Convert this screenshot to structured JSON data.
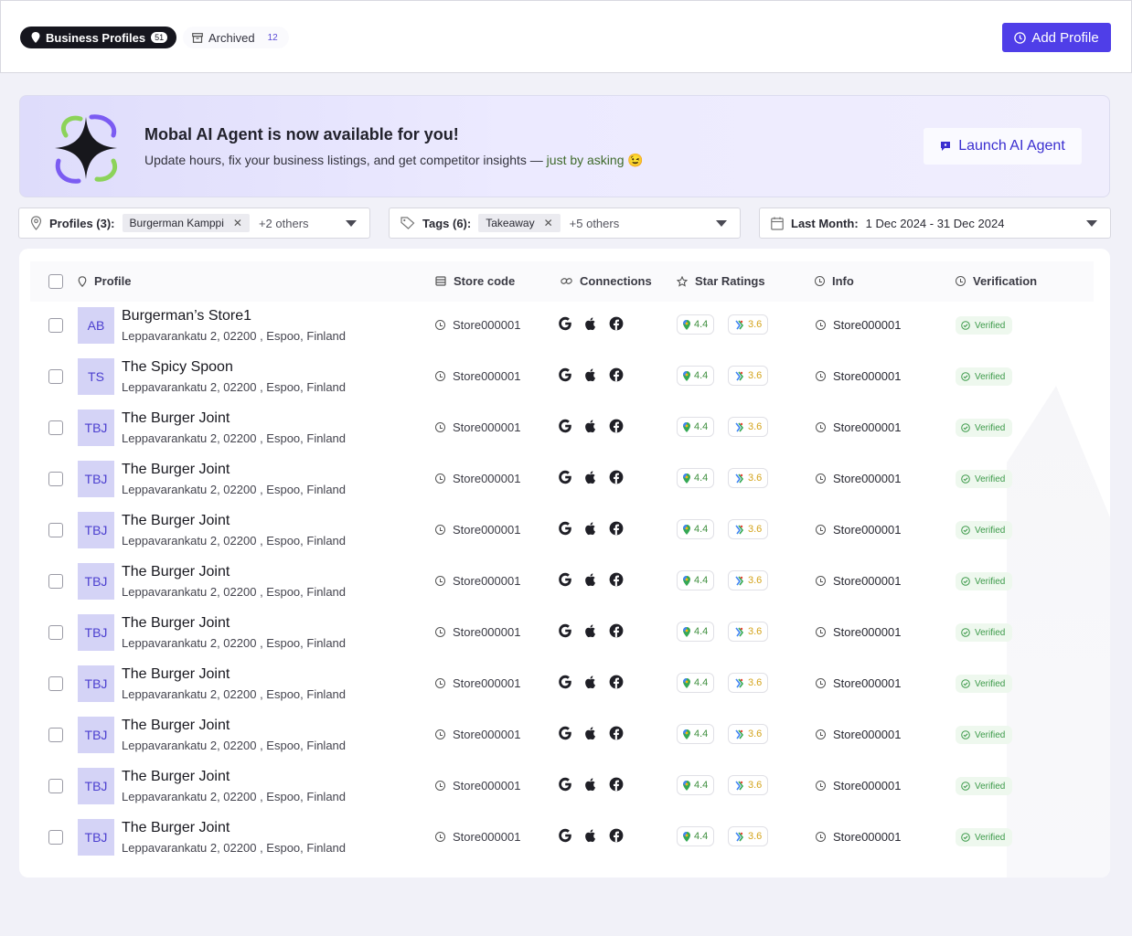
{
  "tabs": {
    "active": {
      "label": "Business Profiles",
      "count": "51"
    },
    "archived": {
      "label": "Archived",
      "count": "12"
    }
  },
  "header": {
    "add_profile_label": "Add Profile"
  },
  "banner": {
    "title": "Mobal AI Agent is now available for you!",
    "subtitle": "Update hours, fix your business listings, and get competitor insights — ",
    "subtitle_accent": "just by asking",
    "emoji": "😉",
    "launch_label": "Launch AI Agent"
  },
  "filters": {
    "profiles": {
      "label": "Profiles (3):",
      "chip": "Burgerman Kamppi",
      "others": "+2 others"
    },
    "tags": {
      "label": "Tags (6):",
      "chip": "Takeaway",
      "others": "+5 others"
    },
    "date": {
      "label": "Last Month:",
      "value": "1 Dec 2024 - 31 Dec 2024"
    }
  },
  "table": {
    "columns": {
      "profile": "Profile",
      "store_code": "Store code",
      "connections": "Connections",
      "star_ratings": "Star Ratings",
      "info": "Info",
      "verification": "Verification"
    },
    "rows": [
      {
        "initials": "AB",
        "name": "Burgerman’s Store1",
        "address": "Leppavarankatu 2, 02200 , Espoo, Finland",
        "store_code": "Store000001",
        "google_rating": "4.4",
        "tripadvisor_rating": "3.6",
        "info": "Store000001",
        "verification": "Verified"
      },
      {
        "initials": "TS",
        "name": "The Spicy Spoon",
        "address": "Leppavarankatu 2, 02200 , Espoo, Finland",
        "store_code": "Store000001",
        "google_rating": "4.4",
        "tripadvisor_rating": "3.6",
        "info": "Store000001",
        "verification": "Verified"
      },
      {
        "initials": "TBJ",
        "name": "The Burger Joint",
        "address": "Leppavarankatu 2, 02200 , Espoo, Finland",
        "store_code": "Store000001",
        "google_rating": "4.4",
        "tripadvisor_rating": "3.6",
        "info": "Store000001",
        "verification": "Verified"
      },
      {
        "initials": "TBJ",
        "name": "The Burger Joint",
        "address": "Leppavarankatu 2, 02200 , Espoo, Finland",
        "store_code": "Store000001",
        "google_rating": "4.4",
        "tripadvisor_rating": "3.6",
        "info": "Store000001",
        "verification": "Verified"
      },
      {
        "initials": "TBJ",
        "name": "The Burger Joint",
        "address": "Leppavarankatu 2, 02200 , Espoo, Finland",
        "store_code": "Store000001",
        "google_rating": "4.4",
        "tripadvisor_rating": "3.6",
        "info": "Store000001",
        "verification": "Verified"
      },
      {
        "initials": "TBJ",
        "name": "The Burger Joint",
        "address": "Leppavarankatu 2, 02200 , Espoo, Finland",
        "store_code": "Store000001",
        "google_rating": "4.4",
        "tripadvisor_rating": "3.6",
        "info": "Store000001",
        "verification": "Verified"
      },
      {
        "initials": "TBJ",
        "name": "The Burger Joint",
        "address": "Leppavarankatu 2, 02200 , Espoo, Finland",
        "store_code": "Store000001",
        "google_rating": "4.4",
        "tripadvisor_rating": "3.6",
        "info": "Store000001",
        "verification": "Verified"
      },
      {
        "initials": "TBJ",
        "name": "The Burger Joint",
        "address": "Leppavarankatu 2, 02200 , Espoo, Finland",
        "store_code": "Store000001",
        "google_rating": "4.4",
        "tripadvisor_rating": "3.6",
        "info": "Store000001",
        "verification": "Verified"
      },
      {
        "initials": "TBJ",
        "name": "The Burger Joint",
        "address": "Leppavarankatu 2, 02200 , Espoo, Finland",
        "store_code": "Store000001",
        "google_rating": "4.4",
        "tripadvisor_rating": "3.6",
        "info": "Store000001",
        "verification": "Verified"
      },
      {
        "initials": "TBJ",
        "name": "The Burger Joint",
        "address": "Leppavarankatu 2, 02200 , Espoo, Finland",
        "store_code": "Store000001",
        "google_rating": "4.4",
        "tripadvisor_rating": "3.6",
        "info": "Store000001",
        "verification": "Verified"
      },
      {
        "initials": "TBJ",
        "name": "The Burger Joint",
        "address": "Leppavarankatu 2, 02200 , Espoo, Finland",
        "store_code": "Store000001",
        "google_rating": "4.4",
        "tripadvisor_rating": "3.6",
        "info": "Store000001",
        "verification": "Verified"
      }
    ]
  },
  "icons": {
    "connections": [
      "google-icon",
      "apple-icon",
      "facebook-icon"
    ],
    "ratings": [
      "google-maps-pin-icon",
      "tripadvisor-icon"
    ]
  },
  "colors": {
    "accent": "#4f3ee8",
    "verified": "#3d9a4a",
    "google_rating": "#3f8f3f",
    "tripadvisor_rating": "#d4a31a",
    "avatar_bg": "#d4d3f6"
  }
}
